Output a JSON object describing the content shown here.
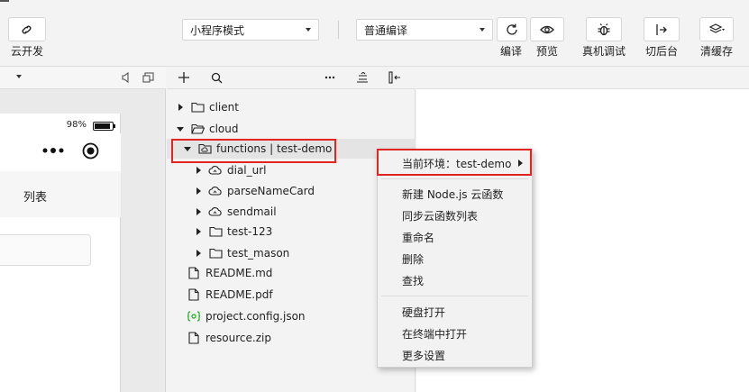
{
  "toolbar": {
    "cloud_dev_label": "云开发",
    "mode_select": "小程序模式",
    "compile_select": "普通编译",
    "compile_label": "编译",
    "preview_label": "预览",
    "remote_debug_label": "真机调试",
    "background_label": "切后台",
    "clear_cache_label": "清缓存"
  },
  "simulator": {
    "battery_percent": "98%",
    "battery_level": 0.92,
    "tab_text": "列表"
  },
  "explorer": {
    "tree": [
      {
        "label": "client",
        "icon": "folder-icon",
        "expanded": false
      },
      {
        "label": "cloud",
        "icon": "folder-open-icon",
        "expanded": true
      },
      {
        "label": "functions | test-demo",
        "icon": "cloud-folder-icon",
        "expanded": true
      },
      {
        "label": "dial_url",
        "icon": "cloud-function-icon"
      },
      {
        "label": "parseNameCard",
        "icon": "cloud-function-icon"
      },
      {
        "label": "sendmail",
        "icon": "cloud-function-icon"
      },
      {
        "label": "test-123",
        "icon": "folder-icon"
      },
      {
        "label": "test_mason",
        "icon": "folder-icon"
      },
      {
        "label": "README.md",
        "icon": "file-icon"
      },
      {
        "label": "README.pdf",
        "icon": "file-icon"
      },
      {
        "label": "project.config.json",
        "icon": "json-config-icon"
      },
      {
        "label": "resource.zip",
        "icon": "file-icon"
      }
    ]
  },
  "context_menu": {
    "env_item": "当前环境：test-demo",
    "items": [
      "新建 Node.js 云函数",
      "同步云函数列表",
      "重命名",
      "删除",
      "查找"
    ],
    "items2": [
      "硬盘打开",
      "在终端中打开",
      "更多设置"
    ]
  },
  "colors": {
    "highlight_red": "#e0261f",
    "json_icon_green": "#1aad19"
  }
}
